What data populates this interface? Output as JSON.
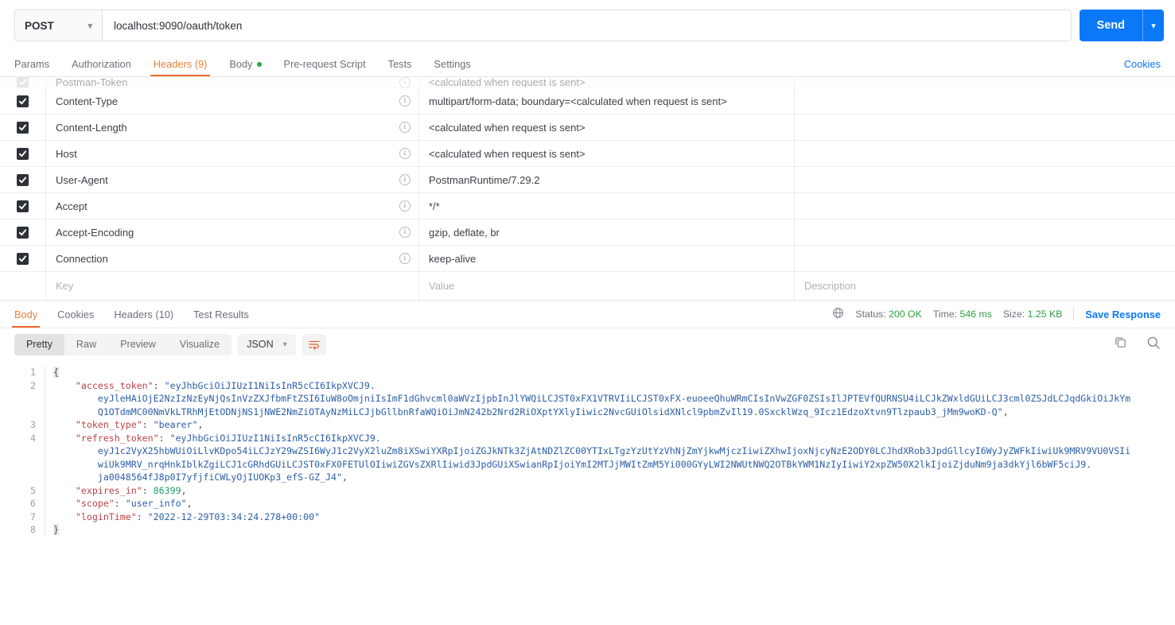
{
  "request": {
    "method": "POST",
    "url": "localhost:9090/oauth/token",
    "send_label": "Send",
    "cookies_label": "Cookies",
    "tabs": [
      {
        "label": "Params",
        "active": false,
        "dot": false
      },
      {
        "label": "Authorization",
        "active": false,
        "dot": false
      },
      {
        "label": "Headers (9)",
        "active": true,
        "dot": false
      },
      {
        "label": "Body",
        "active": false,
        "dot": true
      },
      {
        "label": "Pre-request Script",
        "active": false,
        "dot": false
      },
      {
        "label": "Tests",
        "active": false,
        "dot": false
      },
      {
        "label": "Settings",
        "active": false,
        "dot": false
      }
    ]
  },
  "headers_table": {
    "columns": {
      "key": "Key",
      "value": "Value",
      "description": "Description"
    },
    "rows": [
      {
        "checked": true,
        "muted": true,
        "key": "Postman-Token",
        "value": "<calculated when request is sent>",
        "description": ""
      },
      {
        "checked": true,
        "muted": false,
        "key": "Content-Type",
        "value": "multipart/form-data; boundary=<calculated when request is sent>",
        "description": ""
      },
      {
        "checked": true,
        "muted": false,
        "key": "Content-Length",
        "value": "<calculated when request is sent>",
        "description": ""
      },
      {
        "checked": true,
        "muted": false,
        "key": "Host",
        "value": "<calculated when request is sent>",
        "description": ""
      },
      {
        "checked": true,
        "muted": false,
        "key": "User-Agent",
        "value": "PostmanRuntime/7.29.2",
        "description": ""
      },
      {
        "checked": true,
        "muted": false,
        "key": "Accept",
        "value": "*/*",
        "description": ""
      },
      {
        "checked": true,
        "muted": false,
        "key": "Accept-Encoding",
        "value": "gzip, deflate, br",
        "description": ""
      },
      {
        "checked": true,
        "muted": false,
        "key": "Connection",
        "value": "keep-alive",
        "description": ""
      }
    ]
  },
  "response": {
    "tabs": [
      {
        "label": "Body",
        "active": true
      },
      {
        "label": "Cookies",
        "active": false
      },
      {
        "label": "Headers (10)",
        "active": false
      },
      {
        "label": "Test Results",
        "active": false
      }
    ],
    "status_label": "Status:",
    "status_value": "200 OK",
    "time_label": "Time:",
    "time_value": "546 ms",
    "size_label": "Size:",
    "size_value": "1.25 KB",
    "save_response": "Save Response",
    "view_modes": [
      {
        "label": "Pretty",
        "active": true
      },
      {
        "label": "Raw",
        "active": false
      },
      {
        "label": "Preview",
        "active": false
      },
      {
        "label": "Visualize",
        "active": false
      }
    ],
    "format": "JSON",
    "line_numbers": [
      "1",
      "2",
      "3",
      "4",
      "5",
      "6",
      "7",
      "8"
    ],
    "body_json": {
      "access_token": "eyJhbGciOiJIUzI1NiIsInR5cCI6IkpXVCJ9.eyJleHAiOjE2NzIzNzEyNjQsInVzZXJfbmFtZSI6IuW8oOmjniIsImF1dGhvcml0aWVzIjpbInJlYWQiLCJST0xFX1VTRVIiLCJST0xFX-euoeeQhuWRmCIsInVwZGF0ZSIsIlJPTEVfQURNSU4iLCJkZWxldGUiLCJ3cml0ZSJdLCJqdGkiOiJkYmQ1OTdjMC00NmVkLTRhMjEtODNjNS1jNWE2NmZiOTAyNzMiLCJjbGllbnRfaWQiOiJmN242b2Nrd2RiOXptYXlyIiwic2NvcGUiOlsidXNlcl9pbmZvIl19.0SxcklWzq_9Icz1EdzoXtvn9Tlzpaub3_jMm9woKD-Q",
      "token_type": "bearer",
      "refresh_token": "eyJhbGciOiJIUzI1NiIsInR5cCI6IkpXVCJ9.eyJ1c2VyX25hbWUiOiLlvKDpo54iLCJzY29wZSI6WyJ1c2VyX2luZm8iXSwiYXRpIjoiZGJkNTk3ZjAtNDZlZC00YTIxLTgzYzUtYzVhNjZmYjkwMjczIiwiZXhwIjoxNjcyNzE2ODY0LCJhdXRob3JpdGllcyI6WyJyZWFkIiwiUk9MRV9VU0VSIiwiUk9MRV_nrqHnkIblkZgiLCJ1cGRhdGUiLCJST0xFX0FETUlOIiwiZGVsZXRlIiwid3JpdGUiXSwianRpIjoiYmI2MTJjMWItZmM5Yi000GYyLWI2NWUtNWQ2OTBkYWM1NzIyIiwiY2xpZW50X2lkIjoiZjduNm9ja3dkYjl6bWF5ciJ9.ja0048564fJ8p0I7yfjfiCWLyOjIUOKp3_efS-GZ_J4",
      "expires_in": "86399",
      "scope": "user_info",
      "loginTime": "2022-12-29T03:34:24.278+00:00"
    },
    "body_lines": [
      {
        "n": "1",
        "segs": [
          {
            "t": "{",
            "c": "brace"
          }
        ]
      },
      {
        "n": "2",
        "segs": [
          {
            "t": "    ",
            "c": "p"
          },
          {
            "t": "\"access_token\"",
            "c": "k"
          },
          {
            "t": ": ",
            "c": "p"
          },
          {
            "t": "\"eyJhbGciOiJIUzI1NiIsInR5cCI6IkpXVCJ9.",
            "c": "s"
          }
        ]
      },
      {
        "n": "",
        "segs": [
          {
            "t": "        ",
            "c": "p"
          },
          {
            "t": "eyJleHAiOjE2NzIzNzEyNjQsInVzZXJfbmFtZSI6IuW8oOmjniIsImF1dGhvcml0aWVzIjpbInJlYWQiLCJST0xFX1VTRVIiLCJST0xFX-euoeeQhuWRmCIsInVwZGF0ZSIsIlJPTEVfQURNSU4iLCJkZWxldGUiLCJ3cml0ZSJdLCJqdGkiOiJkYm",
            "c": "s"
          }
        ]
      },
      {
        "n": "",
        "segs": [
          {
            "t": "        ",
            "c": "p"
          },
          {
            "t": "Q1OTdmMC00NmVkLTRhMjEtODNjNS1jNWE2NmZiOTAyNzMiLCJjbGllbnRfaWQiOiJmN242b2Nrd2RiOXptYXlyIiwic2NvcGUiOlsidXNlcl9pbmZvIl19.0SxcklWzq_9Icz1EdzoXtvn9Tlzpaub3_jMm9woKD-Q\"",
            "c": "s"
          },
          {
            "t": ",",
            "c": "p"
          }
        ]
      },
      {
        "n": "3",
        "segs": [
          {
            "t": "    ",
            "c": "p"
          },
          {
            "t": "\"token_type\"",
            "c": "k"
          },
          {
            "t": ": ",
            "c": "p"
          },
          {
            "t": "\"bearer\"",
            "c": "s"
          },
          {
            "t": ",",
            "c": "p"
          }
        ]
      },
      {
        "n": "4",
        "segs": [
          {
            "t": "    ",
            "c": "p"
          },
          {
            "t": "\"refresh_token\"",
            "c": "k"
          },
          {
            "t": ": ",
            "c": "p"
          },
          {
            "t": "\"eyJhbGciOiJIUzI1NiIsInR5cCI6IkpXVCJ9.",
            "c": "s"
          }
        ]
      },
      {
        "n": "",
        "segs": [
          {
            "t": "        ",
            "c": "p"
          },
          {
            "t": "eyJ1c2VyX25hbWUiOiLlvKDpo54iLCJzY29wZSI6WyJ1c2VyX2luZm8iXSwiYXRpIjoiZGJkNTk3ZjAtNDZlZC00YTIxLTgzYzUtYzVhNjZmYjkwMjczIiwiZXhwIjoxNjcyNzE2ODY0LCJhdXRob3JpdGllcyI6WyJyZWFkIiwiUk9MRV9VU0VSIi",
            "c": "s"
          }
        ]
      },
      {
        "n": "",
        "segs": [
          {
            "t": "        ",
            "c": "p"
          },
          {
            "t": "wiUk9MRV_nrqHnkIblkZgiLCJ1cGRhdGUiLCJST0xFX0FETUlOIiwiZGVsZXRlIiwid3JpdGUiXSwianRpIjoiYmI2MTJjMWItZmM5Yi000GYyLWI2NWUtNWQ2OTBkYWM1NzIyIiwiY2xpZW50X2lkIjoiZjduNm9ja3dkYjl6bWF5ciJ9.",
            "c": "s"
          }
        ]
      },
      {
        "n": "",
        "segs": [
          {
            "t": "        ",
            "c": "p"
          },
          {
            "t": "ja0048564fJ8p0I7yfjfiCWLyOjIUOKp3_efS-GZ_J4\"",
            "c": "s"
          },
          {
            "t": ",",
            "c": "p"
          }
        ]
      },
      {
        "n": "5",
        "segs": [
          {
            "t": "    ",
            "c": "p"
          },
          {
            "t": "\"expires_in\"",
            "c": "k"
          },
          {
            "t": ": ",
            "c": "p"
          },
          {
            "t": "86399",
            "c": "n"
          },
          {
            "t": ",",
            "c": "p"
          }
        ]
      },
      {
        "n": "6",
        "segs": [
          {
            "t": "    ",
            "c": "p"
          },
          {
            "t": "\"scope\"",
            "c": "k"
          },
          {
            "t": ": ",
            "c": "p"
          },
          {
            "t": "\"user_info\"",
            "c": "s"
          },
          {
            "t": ",",
            "c": "p"
          }
        ]
      },
      {
        "n": "7",
        "segs": [
          {
            "t": "    ",
            "c": "p"
          },
          {
            "t": "\"loginTime\"",
            "c": "k"
          },
          {
            "t": ": ",
            "c": "p"
          },
          {
            "t": "\"2022-12-29T03:34:24.278+00:00\"",
            "c": "s"
          }
        ]
      },
      {
        "n": "8",
        "segs": [
          {
            "t": "}",
            "c": "brace"
          }
        ]
      }
    ]
  },
  "colors": {
    "accent_orange": "#f06c2d",
    "link_blue": "#0b79f7",
    "status_green": "#2ea043",
    "string_blue": "#2b5ea7",
    "key_red": "#bd4147"
  }
}
